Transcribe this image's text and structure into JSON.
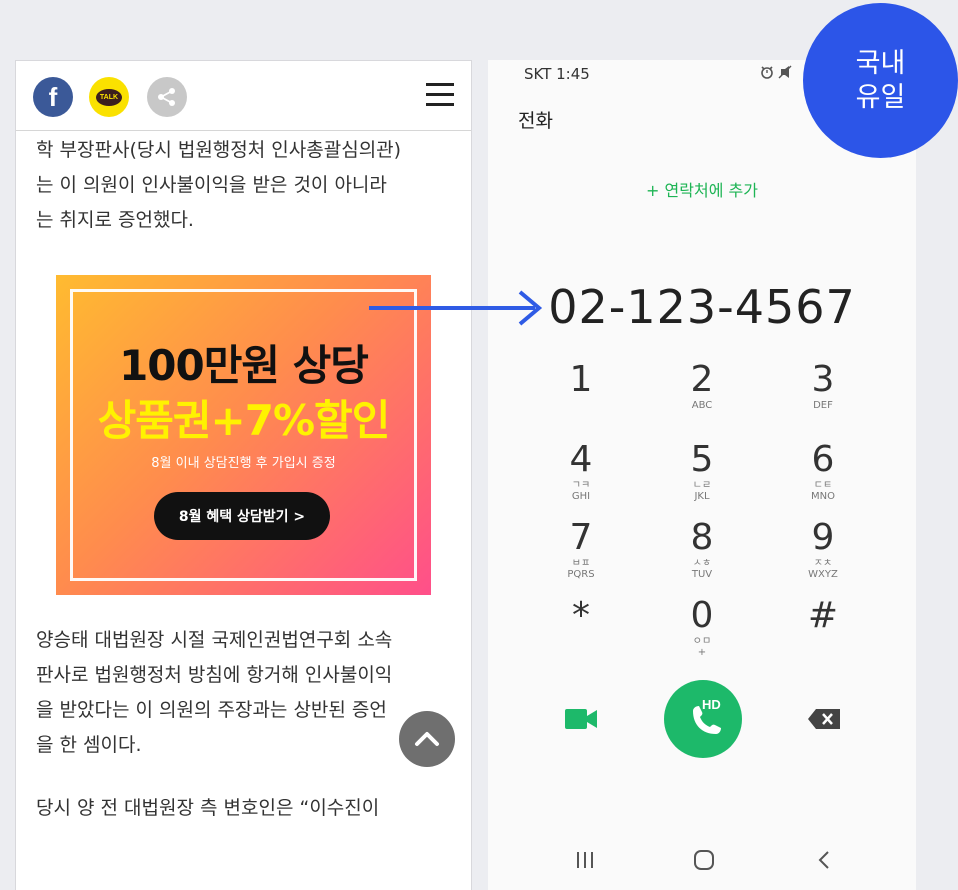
{
  "left_panel": {
    "share_buttons": {
      "facebook_label": "f",
      "kakao_label": "TALK"
    },
    "article": {
      "paragraph1": [
        "학 부장판사(당시 법원행정처 인사총괄심의관)",
        "는 이 의원이 인사불이익을 받은 것이 아니라",
        "는 취지로 증언했다."
      ],
      "paragraph2": [
        "양승태 대법원장 시절 국제인권법연구회 소속",
        "판사로 법원행정처 방침에 항거해 인사불이익",
        "을 받았다는 이 의원의 주장과는 상반된 증언",
        "을 한 셈이다."
      ],
      "paragraph3": [
        "당시 양 전 대법원장 측 변호인은 “이수진이"
      ]
    },
    "ad": {
      "title": "100만원 상당",
      "subtitle": "상품권+7%할인",
      "note": "8월 이내 상담진행 후 가입시 증정",
      "cta": "8월 혜택 상담받기 >"
    }
  },
  "phone": {
    "status_bar": {
      "carrier_time": "SKT 1:45"
    },
    "title": "전화",
    "add_contact": "+ 연락처에 추가",
    "number": "02-123-4567",
    "keypad": [
      {
        "digit": "1",
        "letters": "",
        "sub": ""
      },
      {
        "digit": "2",
        "letters": "",
        "sub": "ABC"
      },
      {
        "digit": "3",
        "letters": "",
        "sub": "DEF"
      },
      {
        "digit": "4",
        "letters": "ㄱㅋ",
        "sub": "GHI"
      },
      {
        "digit": "5",
        "letters": "ㄴㄹ",
        "sub": "JKL"
      },
      {
        "digit": "6",
        "letters": "ㄷㅌ",
        "sub": "MNO"
      },
      {
        "digit": "7",
        "letters": "ㅂㅍ",
        "sub": "PQRS"
      },
      {
        "digit": "8",
        "letters": "ㅅㅎ",
        "sub": "TUV"
      },
      {
        "digit": "9",
        "letters": "ㅈㅊ",
        "sub": "WXYZ"
      },
      {
        "digit": "*",
        "letters": "",
        "sub": ""
      },
      {
        "digit": "0",
        "letters": "ㅇㅁ",
        "sub": "+"
      },
      {
        "digit": "#",
        "letters": "",
        "sub": ""
      }
    ],
    "call_label": "HD",
    "colors": {
      "accent_green": "#1db96a",
      "badge_blue": "#2c55e8"
    }
  },
  "badge": {
    "text": "국내\n유일"
  },
  "icons": [
    "facebook-icon",
    "kakaotalk-icon",
    "share-icon",
    "hamburger-menu-icon",
    "chevron-up-icon",
    "video-call-icon",
    "phone-icon",
    "backspace-icon",
    "recent-apps-icon",
    "home-icon",
    "back-icon",
    "alarm-icon",
    "mute-icon",
    "arrow-right-icon"
  ]
}
